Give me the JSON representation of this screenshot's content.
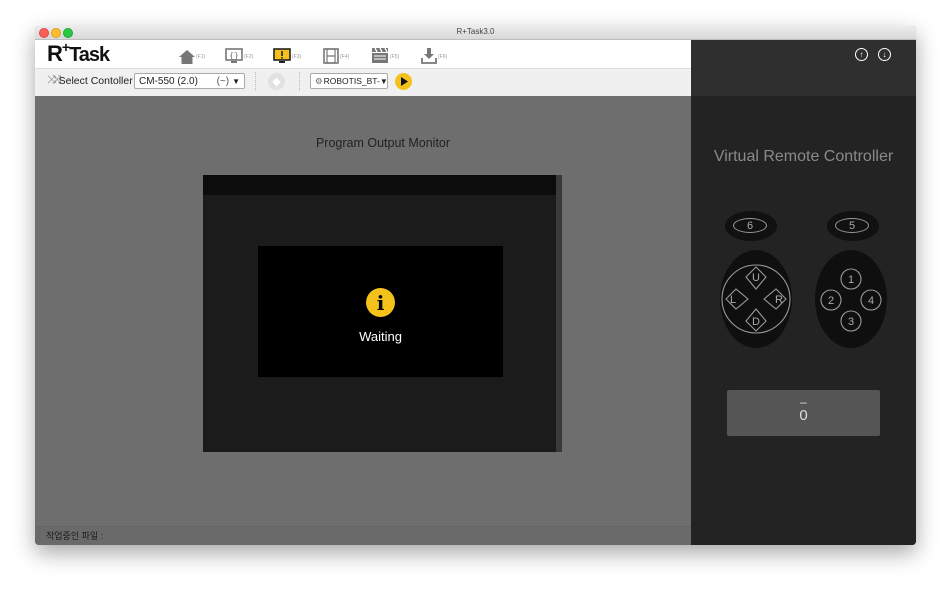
{
  "window": {
    "title": "R+Task3.0"
  },
  "logo": {
    "r": "R",
    "plus": "+",
    "task": "Task"
  },
  "nav": [
    {
      "name": "home",
      "key": "(F1)"
    },
    {
      "name": "code",
      "key": "(F2)"
    },
    {
      "name": "monitor",
      "key": "(F3)"
    },
    {
      "name": "motion",
      "key": "(F4)"
    },
    {
      "name": "scene",
      "key": "(F5)"
    },
    {
      "name": "download",
      "key": "(F6)"
    }
  ],
  "toolbar": {
    "select_controller_label": "Select Contoller",
    "controller_value": "CM-550 (2.0)",
    "controller_version": "(~)",
    "port_value": "ROBOTIS_BT-",
    "dropdown_arrow": "▼"
  },
  "main": {
    "monitor_title": "Program Output Monitor",
    "info_glyph": "i",
    "waiting_text": "Waiting",
    "status_text": "작업중인 파일 :"
  },
  "remote": {
    "title": "Virtual Remote Controller",
    "btn_6": "6",
    "btn_5": "5",
    "dpad": {
      "u": "U",
      "l": "L",
      "r": "R",
      "d": "D"
    },
    "numpad": {
      "n1": "1",
      "n2": "2",
      "n3": "3",
      "n4": "4"
    },
    "readout_dash": "–",
    "readout_value": "0"
  },
  "colors": {
    "accent": "#f5c21b",
    "panel": "#232323",
    "workspace": "#6e6e6e"
  }
}
